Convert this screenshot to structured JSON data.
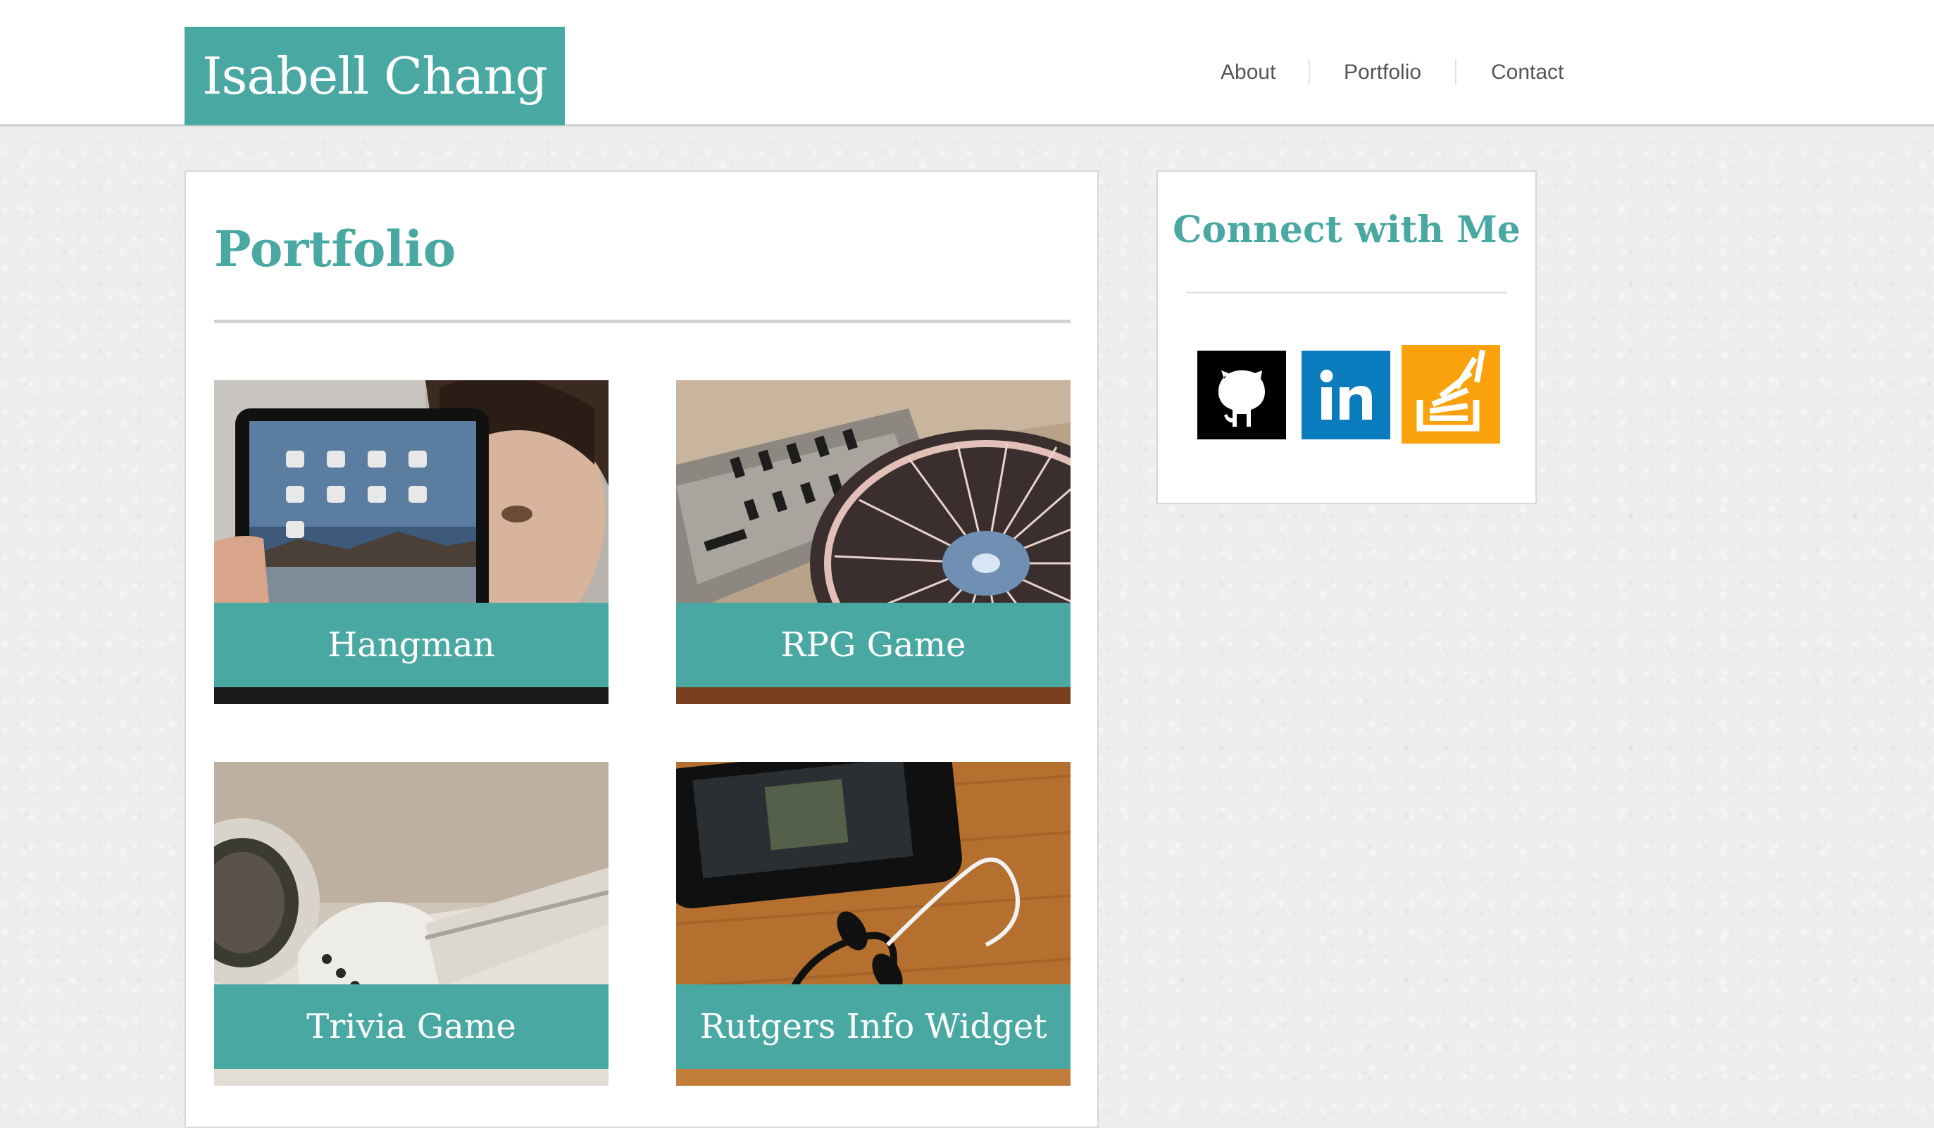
{
  "site": {
    "brand_name": "Isabell Chang"
  },
  "nav": {
    "items": [
      {
        "label": "About"
      },
      {
        "label": "Portfolio"
      },
      {
        "label": "Contact"
      }
    ]
  },
  "main": {
    "title": "Portfolio",
    "projects": [
      {
        "label": "Hangman",
        "image": "tablet-photo"
      },
      {
        "label": "RPG Game",
        "image": "dj-turntable-photo"
      },
      {
        "label": "Trivia Game",
        "image": "earbuds-photo"
      },
      {
        "label": "Rutgers Info Widget",
        "image": "smartphone-earphones-photo"
      }
    ]
  },
  "sidebar": {
    "title": "Connect with Me",
    "social": [
      {
        "name": "github-icon",
        "bg_color": "#000000"
      },
      {
        "name": "linkedin-icon",
        "bg_color": "#0a7bbc"
      },
      {
        "name": "stackoverflow-icon",
        "bg_color": "#f9a20b"
      }
    ]
  },
  "colors": {
    "accent": "#4aa8a3",
    "page_background": "#eeeeee",
    "nav_text": "#555555"
  }
}
